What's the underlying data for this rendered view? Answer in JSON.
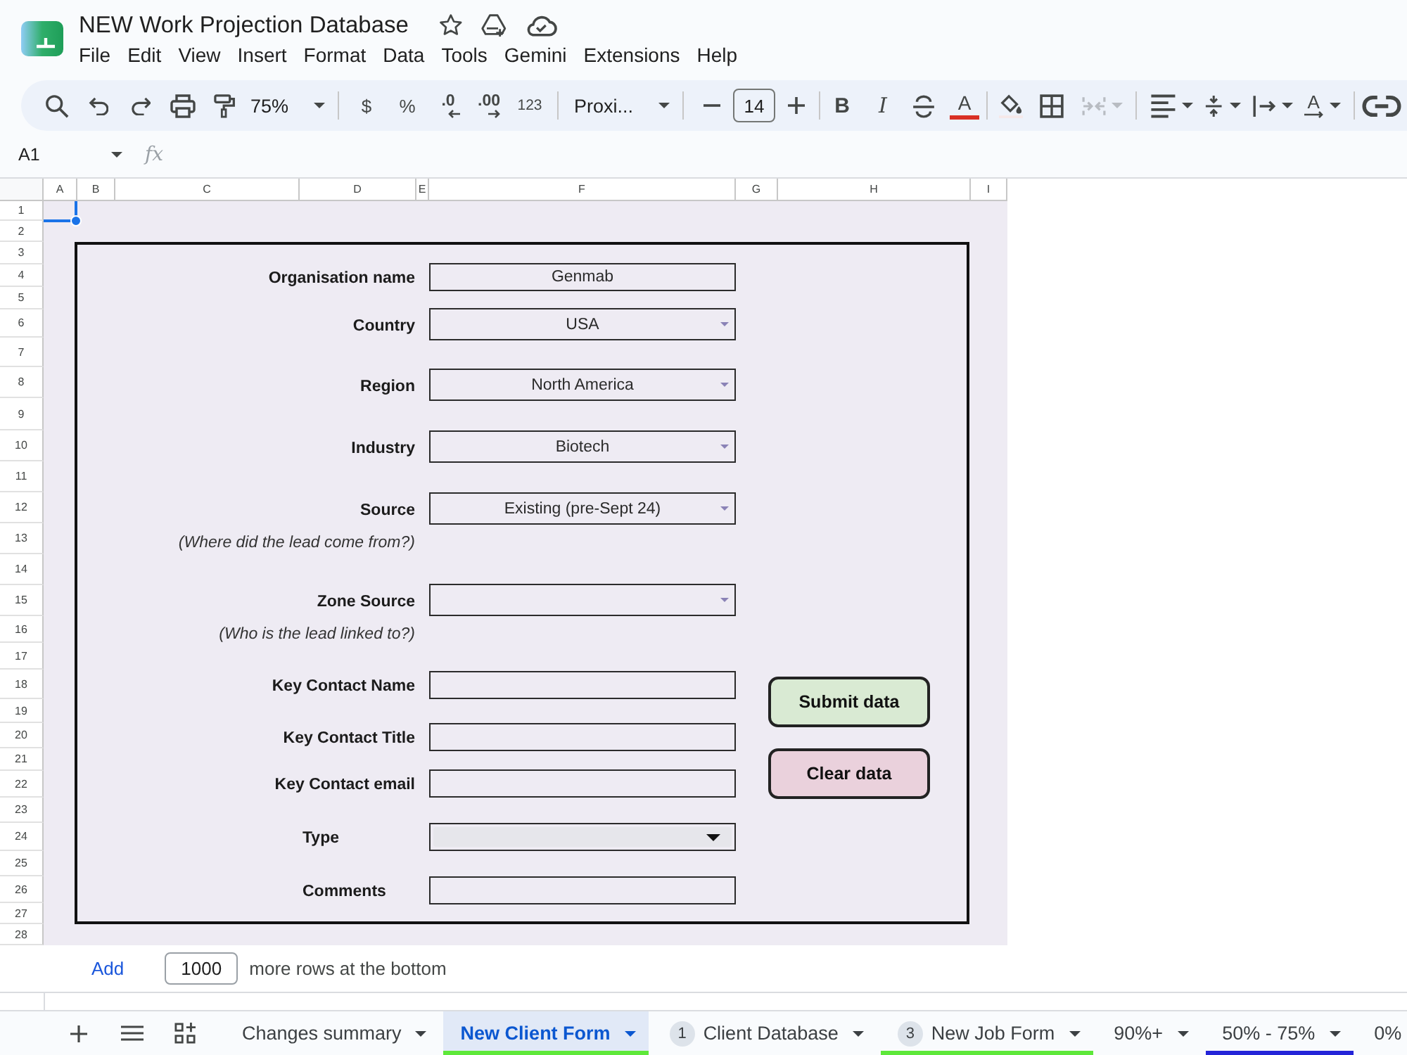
{
  "app": {
    "title": "NEW Work Projection Database"
  },
  "menu": [
    "File",
    "Edit",
    "View",
    "Insert",
    "Format",
    "Data",
    "Tools",
    "Gemini",
    "Extensions",
    "Help"
  ],
  "toolbar": {
    "zoom": "75%",
    "currency": "$",
    "percent": "%",
    "decrease_decimal": ".0",
    "increase_decimal": ".00",
    "number_format": "123",
    "font": "Proxi...",
    "font_size": "14",
    "bold": "B",
    "italic": "I",
    "text_color": "A",
    "text_rotation": "A",
    "merge_disabled": true
  },
  "formula_bar": {
    "cell": "A1",
    "fx": "fx"
  },
  "sheet": {
    "columns": [
      "A",
      "B",
      "C",
      "D",
      "E",
      "F",
      "G",
      "H",
      "I"
    ],
    "rows": [
      "1",
      "2",
      "3",
      "4",
      "5",
      "6",
      "7",
      "8",
      "9",
      "10",
      "11",
      "12",
      "13",
      "14",
      "15",
      "16",
      "17",
      "18",
      "19",
      "20",
      "21",
      "22",
      "23",
      "24",
      "25",
      "26",
      "27",
      "28"
    ]
  },
  "form": {
    "fields": [
      {
        "label": "Organisation name",
        "kind": "text",
        "value": "Genmab"
      },
      {
        "label": "Country",
        "kind": "dropdown",
        "value": "USA"
      },
      {
        "label": "Region",
        "kind": "dropdown",
        "value": "North America"
      },
      {
        "label": "Industry",
        "kind": "dropdown",
        "value": "Biotech"
      },
      {
        "label": "Source",
        "kind": "dropdown",
        "value": "Existing (pre-Sept 24)",
        "note": "(Where did the lead come from?)"
      },
      {
        "label": "Zone Source",
        "kind": "dropdown",
        "note": "(Who is the lead linked to?)"
      },
      {
        "label": "Key Contact Name",
        "kind": "text"
      },
      {
        "label": "Key Contact Title",
        "kind": "text"
      },
      {
        "label": "Key Contact email",
        "kind": "text"
      },
      {
        "label": "Type",
        "kind": "chip"
      },
      {
        "label": "Comments",
        "kind": "text"
      }
    ],
    "buttons": [
      {
        "label": "Submit data",
        "color": "#d9ead3"
      },
      {
        "label": "Clear data",
        "color": "#ead1dc"
      }
    ]
  },
  "add_rows": {
    "link": "Add",
    "value": "1000",
    "text": "more rows at the bottom"
  },
  "sheet_tabs": [
    {
      "label": "Changes summary",
      "selected": false,
      "menu": true
    },
    {
      "label": "New Client Form",
      "selected": true,
      "menu": true,
      "color": "#5ee83a"
    },
    {
      "label": "Client Database",
      "badge": "1",
      "selected": false,
      "menu": true
    },
    {
      "label": "New Job Form",
      "badge": "3",
      "selected": false,
      "menu": true,
      "color": "#5ee83a"
    },
    {
      "label": "90%+",
      "selected": false,
      "menu": true
    },
    {
      "label": "50% - 75%",
      "selected": false,
      "menu": true,
      "color": "#2424d8"
    },
    {
      "label": "0%",
      "selected": false,
      "menu": false
    }
  ]
}
